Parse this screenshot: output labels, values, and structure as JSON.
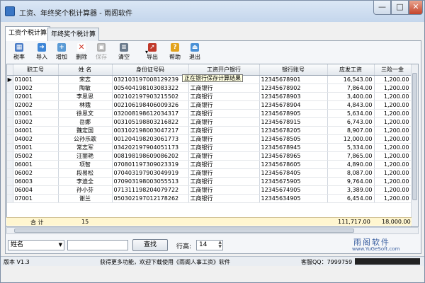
{
  "window": {
    "title": "工资、年终奖个税计算器 - 雨阁软件",
    "controls": {
      "minimize": "—",
      "maximize": "□",
      "close": "✕"
    }
  },
  "tabs": [
    {
      "label": "工资个税计算",
      "active": true
    },
    {
      "label": "年终奖个税计算",
      "active": false
    }
  ],
  "toolbar": [
    {
      "label": "税率",
      "icon": "table-icon",
      "color": "#4a7cc7",
      "enabled": true
    },
    {
      "label": "导入",
      "icon": "import-icon",
      "color": "#3f86d6",
      "enabled": true
    },
    {
      "label": "增加",
      "icon": "add-icon",
      "color": "#5b9bd5",
      "enabled": true
    },
    {
      "label": "删除",
      "icon": "delete-icon",
      "color": "#d03a2c",
      "enabled": true
    },
    {
      "label": "保存",
      "icon": "save-icon",
      "color": "#b0b0b0",
      "enabled": false
    },
    {
      "label": "清空",
      "icon": "clear-icon",
      "color": "#6a7a8c",
      "enabled": true
    },
    {
      "label": "导出",
      "icon": "export-icon",
      "color": "#c0392b",
      "enabled": true
    },
    {
      "label": "帮助",
      "icon": "help-icon",
      "color": "#e2a21b",
      "enabled": true
    },
    {
      "label": "退出",
      "icon": "exit-icon",
      "color": "#4a90d6",
      "enabled": true
    }
  ],
  "grid": {
    "columns": [
      "职工号",
      "姓  名",
      "身份证号码",
      "工资开户银行",
      "银行账号",
      "应发工资",
      "三险一金"
    ],
    "rows": [
      [
        "01001",
        "宋志",
        "032103197008129239",
        "",
        "12345678901",
        "16,543.00",
        "1,200.00"
      ],
      [
        "01002",
        "陶敏",
        "005404198103083322",
        "工商银行",
        "12345678902",
        "7,864.00",
        "1,200.00"
      ],
      [
        "02001",
        "李思思",
        "002102197903215502",
        "工商银行",
        "12345678903",
        "3,400.00",
        "1,200.00"
      ],
      [
        "02002",
        "林娥",
        "002106198406009326",
        "工商银行",
        "12345678904",
        "4,843.00",
        "1,200.00"
      ],
      [
        "03001",
        "徐思文",
        "032008198612034317",
        "工商银行",
        "12345678905",
        "5,634.00",
        "1,200.00"
      ],
      [
        "03002",
        "岳娜",
        "003105198803216822",
        "工商银行",
        "12345678915",
        "6,743.00",
        "1,200.00"
      ],
      [
        "04001",
        "魏定国",
        "003102198003047217",
        "工商银行",
        "12345678205",
        "8,907.00",
        "1,200.00"
      ],
      [
        "04002",
        "公孙乐歌",
        "001204198203061773",
        "工商银行",
        "12345678505",
        "12,000.00",
        "1,200.00"
      ],
      [
        "05001",
        "常志军",
        "034202197904051173",
        "工商银行",
        "12345678945",
        "5,334.00",
        "1,200.00"
      ],
      [
        "05002",
        "汪丽艳",
        "008198198609086202",
        "工商银行",
        "12345678965",
        "7,865.00",
        "1,200.00"
      ],
      [
        "06001",
        "项智",
        "070801197309023319",
        "工商银行",
        "12345678605",
        "4,890.00",
        "1,200.00"
      ],
      [
        "06002",
        "段易松",
        "070403197903049919",
        "工商银行",
        "12345678405",
        "8,087.00",
        "1,200.00"
      ],
      [
        "06003",
        "李迪全",
        "070903198003055513",
        "工商银行",
        "12345675905",
        "9,764.00",
        "1,200.00"
      ],
      [
        "06004",
        "孙小芬",
        "071311198204079722",
        "工商银行",
        "12345674905",
        "3,389.00",
        "1,200.00"
      ],
      [
        "07001",
        "谢兰",
        "050302197012178262",
        "工商银行",
        "12345634905",
        "6,454.00",
        "1,200.00"
      ]
    ],
    "current_row_marker": "▶",
    "tooltip": "正在银行保存计算结果"
  },
  "totals": {
    "label": "合 计",
    "count": "15",
    "salary_total": "111,717.00",
    "insurance_total": "18,000.00"
  },
  "bottom": {
    "search_field": "姓名",
    "search_value": "",
    "search_button": "查找",
    "row_height_label": "行高:",
    "row_height_value": "14",
    "logo_title": "雨阁软件",
    "logo_url": "www.YuGeSoft.com"
  },
  "status": {
    "version": "版本 V1.3",
    "promo": "获得更多功能，欢迎下载使用《雨阁人事工资》软件",
    "qq": "客服QQ：7999759"
  }
}
